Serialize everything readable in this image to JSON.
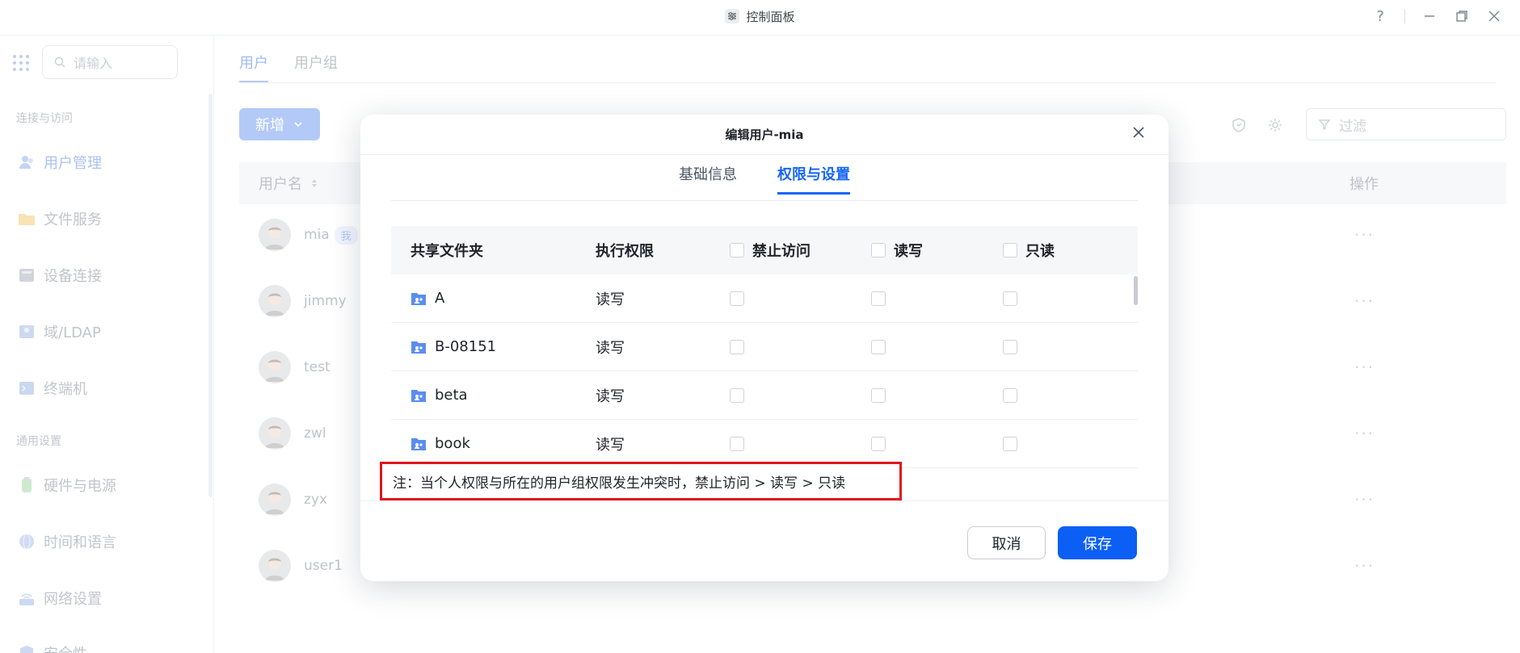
{
  "window": {
    "title": "控制面板",
    "help": "?"
  },
  "sidebar": {
    "search_placeholder": "请输入",
    "group1": "连接与访问",
    "group2": "通用设置",
    "items": [
      {
        "label": "用户管理",
        "icon": "users-icon",
        "active": true
      },
      {
        "label": "文件服务",
        "icon": "folder-icon"
      },
      {
        "label": "设备连接",
        "icon": "device-icon"
      },
      {
        "label": "域/LDAP",
        "icon": "ldap-icon"
      },
      {
        "label": "终端机",
        "icon": "terminal-icon"
      },
      {
        "label": "硬件与电源",
        "icon": "power-icon"
      },
      {
        "label": "时间和语言",
        "icon": "globe-icon"
      },
      {
        "label": "网络设置",
        "icon": "network-icon"
      },
      {
        "label": "安全性",
        "icon": "shield-icon"
      }
    ]
  },
  "main": {
    "tabs": [
      {
        "label": "用户"
      },
      {
        "label": "用户组"
      }
    ],
    "add_button": "新增",
    "filter_placeholder": "过滤",
    "col_name": "用户名",
    "col_ops": "操作",
    "more": "···",
    "me_badge": "我",
    "users": [
      "mia",
      "jimmy",
      "test",
      "zwl",
      "zyx",
      "user1"
    ]
  },
  "dialog": {
    "title": "编辑用户-mia",
    "tabs": [
      "基础信息",
      "权限与设置"
    ],
    "active_tab": 1,
    "headers": {
      "folder": "共享文件夹",
      "perm": "执行权限",
      "deny": "禁止访问",
      "rw": "读写",
      "ro": "只读"
    },
    "rows": [
      {
        "name": "A",
        "perm": "读写"
      },
      {
        "name": "B-08151",
        "perm": "读写"
      },
      {
        "name": "beta",
        "perm": "读写"
      },
      {
        "name": "book",
        "perm": "读写"
      }
    ],
    "note": "注：当个人权限与所在的用户组权限发生冲突时，禁止访问 > 读写 > 只读",
    "cancel": "取消",
    "save": "保存"
  },
  "colors": {
    "accent": "#1766F5",
    "highlight_border": "#E0161D"
  }
}
